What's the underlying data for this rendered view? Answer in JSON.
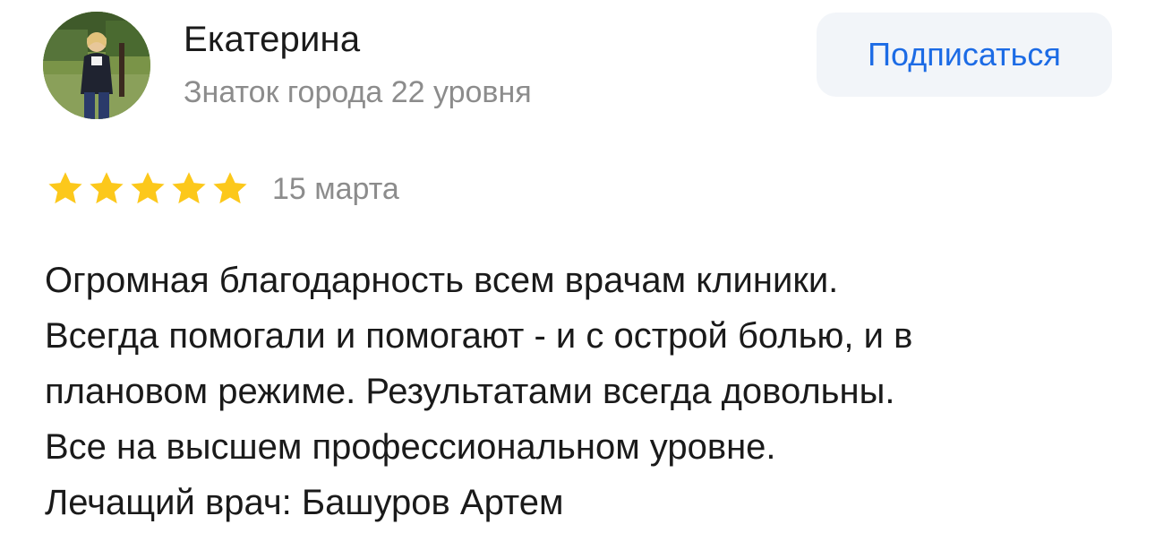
{
  "author": {
    "name": "Екатерина",
    "level": "Знаток города 22 уровня"
  },
  "subscribe": {
    "label": "Подписаться"
  },
  "review": {
    "rating": 5,
    "rating_max": 5,
    "date": "15 марта",
    "lines": [
      "Огромная благодарность всем врачам клиники.",
      "Всегда помогали и помогают - и с острой болью, и в",
      "плановом режиме. Результатами всегда довольны.",
      "Все на высшем профессиональном уровне.",
      "Лечащий врач: Башуров Артем"
    ]
  },
  "colors": {
    "star": "#fcc81b",
    "accent": "#1c6be5",
    "muted": "#8c8c8c",
    "button_bg": "#f2f5f9"
  },
  "icons": {
    "avatar": "user-photo",
    "star": "star-icon"
  }
}
